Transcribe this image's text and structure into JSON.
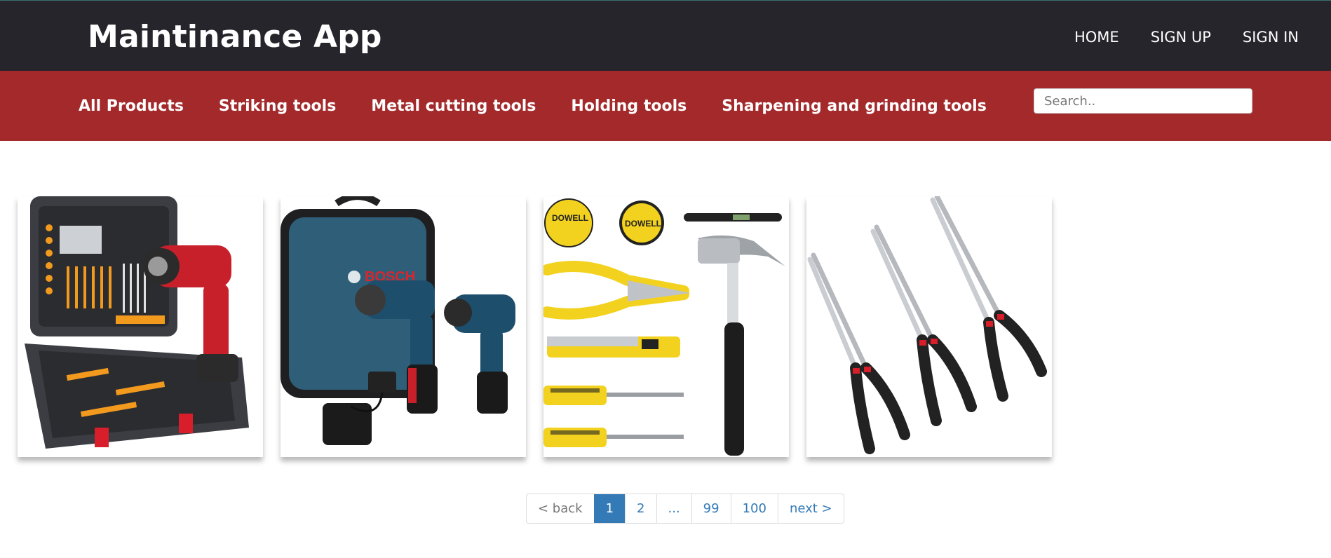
{
  "header": {
    "brand": "Maintinance App",
    "nav": [
      "HOME",
      "SIGN UP",
      "SIGN IN"
    ]
  },
  "categories": [
    "All Products",
    "Striking tools",
    "Metal cutting tools",
    "Holding tools",
    "Sharpening and grinding tools"
  ],
  "search": {
    "placeholder": "Search.."
  },
  "products": [
    {
      "icon": "toolkit-case-icon",
      "brand_text": ""
    },
    {
      "icon": "bosch-drill-bag-icon",
      "brand_text": "BOSCH"
    },
    {
      "icon": "hand-tool-set-icon",
      "brand_text": "DOWELL"
    },
    {
      "icon": "long-nose-pliers-icon",
      "brand_text": ""
    }
  ],
  "pagination": {
    "back": "< back",
    "pages": [
      "1",
      "2",
      "...",
      "99",
      "100"
    ],
    "next": "next >",
    "current": "1"
  },
  "colors": {
    "topbar": "#25252b",
    "catbar": "#a3292b",
    "link": "#337ab7"
  }
}
